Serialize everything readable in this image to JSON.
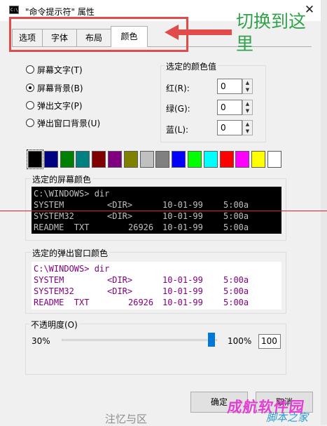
{
  "window": {
    "title": "\"命令提示符\" 属性",
    "icon": "console-app-icon",
    "icon_text": "C:\\",
    "close_label": "✕"
  },
  "tabs": [
    {
      "label": "选项",
      "active": false
    },
    {
      "label": "字体",
      "active": false
    },
    {
      "label": "布局",
      "active": false
    },
    {
      "label": "颜色",
      "active": true
    }
  ],
  "annotation": {
    "text": "切换到这里",
    "box_color": "#e34a4a",
    "text_color": "#31a34a"
  },
  "color_targets": [
    {
      "label": "屏幕文字(T)",
      "selected": false
    },
    {
      "label": "屏幕背景(B)",
      "selected": true
    },
    {
      "label": "弹出文字(P)",
      "selected": false
    },
    {
      "label": "弹出窗口背景(U)",
      "selected": false
    }
  ],
  "color_values": {
    "title": "选定的颜色值",
    "red": {
      "label": "红(R):",
      "value": "0"
    },
    "green": {
      "label": "绿(G):",
      "value": "0"
    },
    "blue": {
      "label": "蓝(L):",
      "value": "0"
    }
  },
  "palette": [
    "#000000",
    "#000080",
    "#008000",
    "#008080",
    "#800000",
    "#800080",
    "#808000",
    "#c0c0c0",
    "#808080",
    "#0000ff",
    "#00ff00",
    "#00ffff",
    "#ff0000",
    "#ff00ff",
    "#ffff00",
    "#ffffff"
  ],
  "screen_colors": {
    "title": "选定的屏幕颜色",
    "bg": "#000000",
    "fg": "#c0c0c0",
    "prompt": "C:\\WINDOWS> dir",
    "rows": [
      [
        "SYSTEM",
        "<DIR>",
        "10-01-99",
        "5:00a"
      ],
      [
        "SYSTEM32",
        "<DIR>",
        "10-01-99",
        "5:00a"
      ],
      [
        "README  TXT",
        "26926",
        "10-01-99",
        "5:00a"
      ]
    ]
  },
  "popup_colors": {
    "title": "选定的弹出窗口颜色",
    "bg": "#ffffff",
    "fg": "#800080",
    "prompt": "C:\\WINDOWS> dir",
    "rows": [
      [
        "SYSTEM",
        "<DIR>",
        "10-01-99",
        "5:00a"
      ],
      [
        "SYSTEM32",
        "<DIR>",
        "10-01-99",
        "5:00a"
      ],
      [
        "README  TXT",
        "26926",
        "10-01-99",
        "5:00a"
      ]
    ]
  },
  "opacity": {
    "title": "不透明度(O)",
    "min_label": "30%",
    "max_label": "100%",
    "value": "100",
    "level_percent": 100
  },
  "footer": {
    "ok_label": "确定",
    "cancel_label": "取消"
  },
  "background_text": "注忆与区",
  "watermark": {
    "line1": "成航软件园",
    "line2": "脚本之家"
  }
}
